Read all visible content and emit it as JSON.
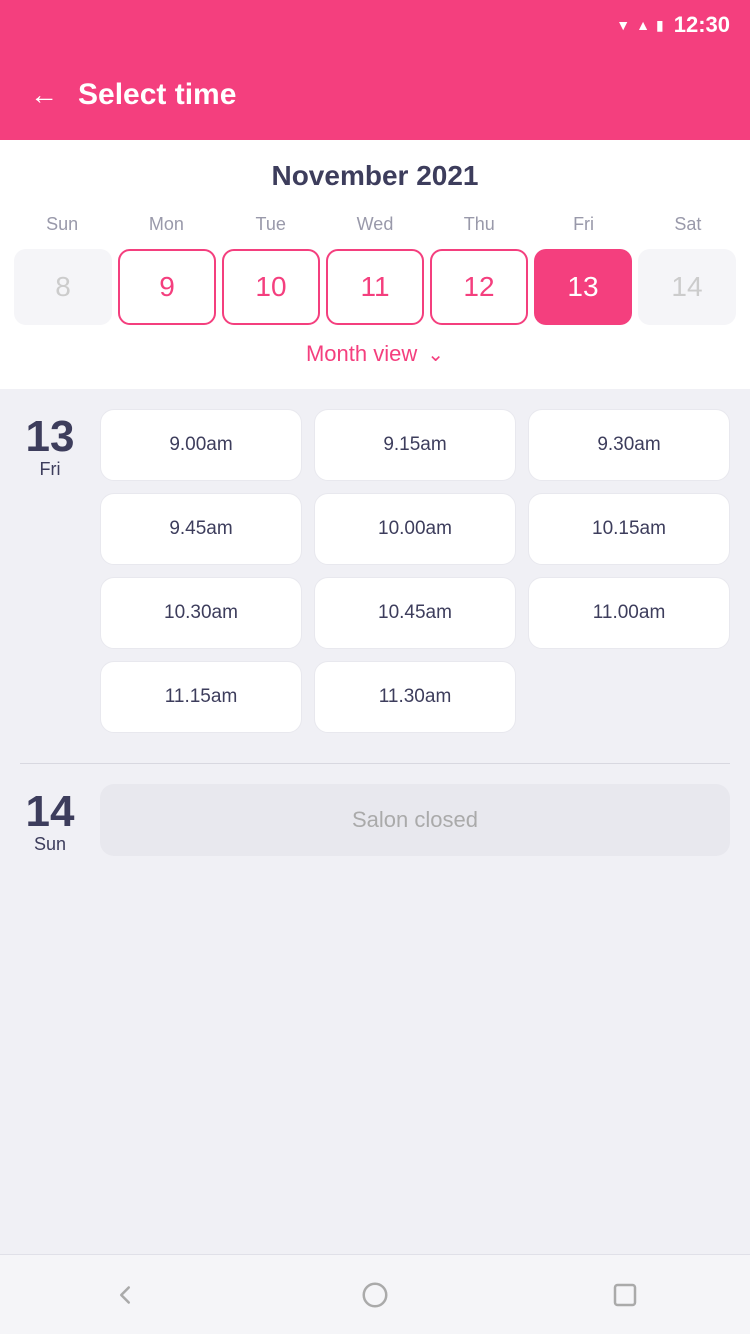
{
  "statusBar": {
    "time": "12:30"
  },
  "header": {
    "title": "Select time",
    "backLabel": "←"
  },
  "calendar": {
    "monthYear": "November 2021",
    "weekDays": [
      "Sun",
      "Mon",
      "Tue",
      "Wed",
      "Thu",
      "Fri",
      "Sat"
    ],
    "dates": [
      {
        "value": "8",
        "state": "inactive"
      },
      {
        "value": "9",
        "state": "active"
      },
      {
        "value": "10",
        "state": "active"
      },
      {
        "value": "11",
        "state": "active"
      },
      {
        "value": "12",
        "state": "active"
      },
      {
        "value": "13",
        "state": "selected"
      },
      {
        "value": "14",
        "state": "inactive"
      }
    ],
    "monthViewLabel": "Month view"
  },
  "daySlots": [
    {
      "dayNumber": "13",
      "dayName": "Fri",
      "slots": [
        "9.00am",
        "9.15am",
        "9.30am",
        "9.45am",
        "10.00am",
        "10.15am",
        "10.30am",
        "10.45am",
        "11.00am",
        "11.15am",
        "11.30am"
      ]
    }
  ],
  "closedDay": {
    "dayNumber": "14",
    "dayName": "Sun",
    "message": "Salon closed"
  },
  "nav": {
    "back": "back-icon",
    "home": "home-icon",
    "recents": "recents-icon"
  }
}
